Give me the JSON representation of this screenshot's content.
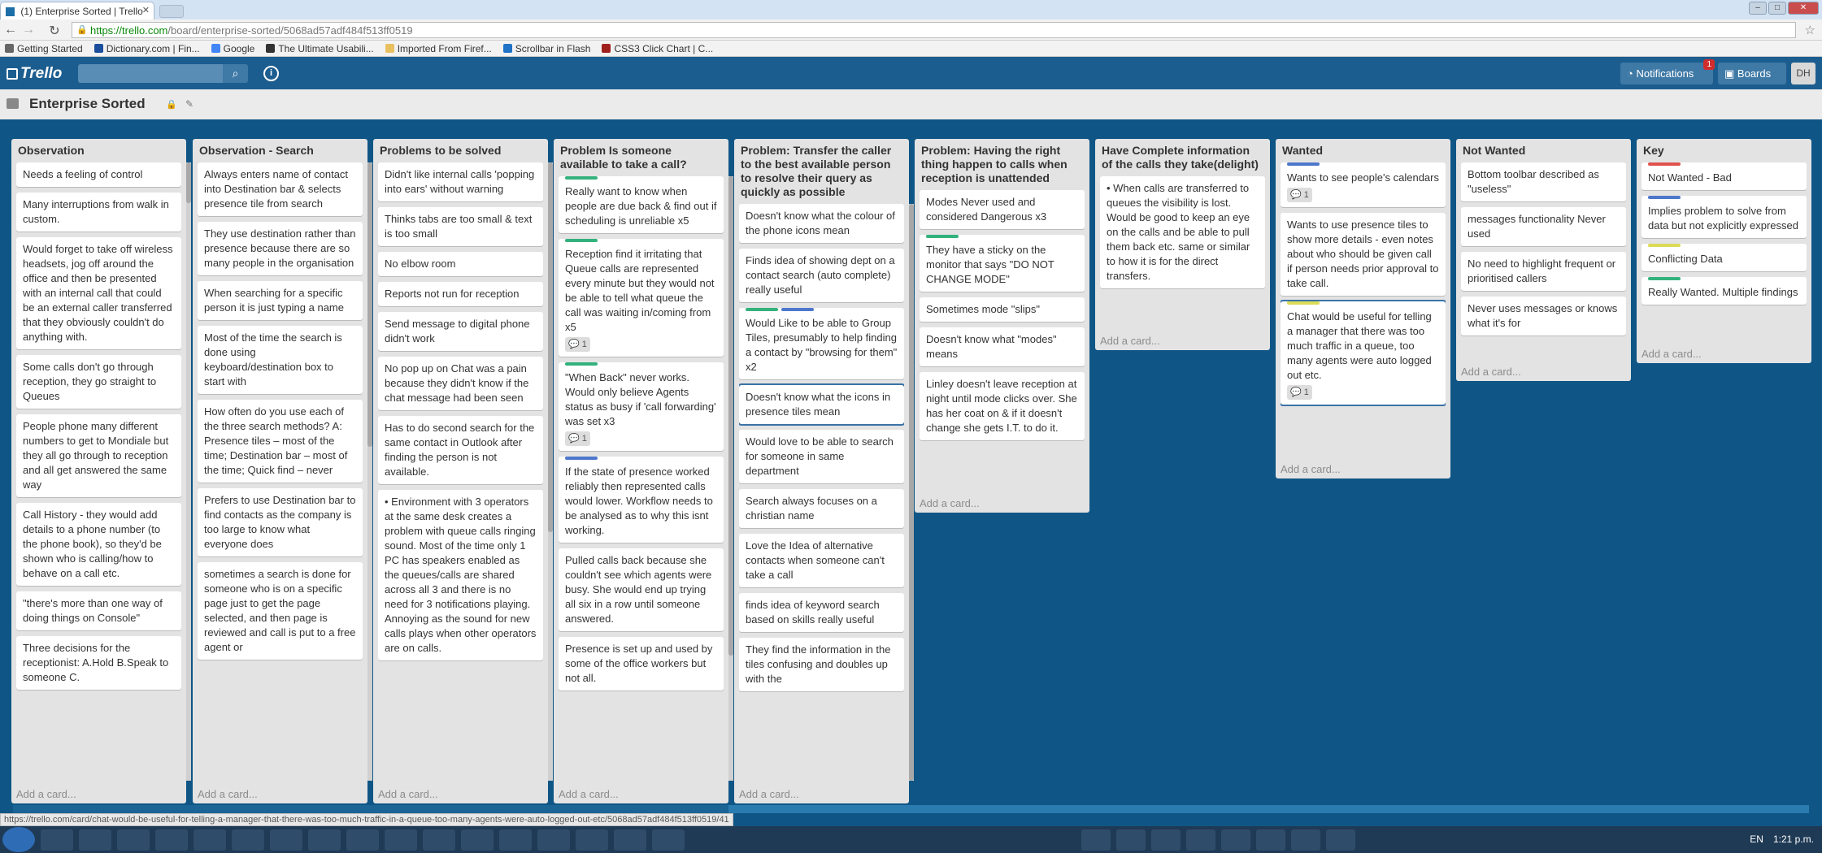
{
  "browser": {
    "tab_title": "(1) Enterprise Sorted | Trello",
    "url_scheme": "https://",
    "url_host": "trello.com",
    "url_path": "/board/enterprise-sorted/5068ad57adf484f513ff0519",
    "bookmarks": [
      {
        "label": "Getting Started",
        "color": "#666"
      },
      {
        "label": "Dictionary.com | Fin...",
        "color": "#1b4f9c"
      },
      {
        "label": "Google",
        "color": "#4285f4"
      },
      {
        "label": "The Ultimate Usabili...",
        "color": "#333"
      },
      {
        "label": "Imported From Firef...",
        "color": "#e8c060"
      },
      {
        "label": "Scrollbar in Flash",
        "color": "#1f72c6"
      },
      {
        "label": "CSS3 Click Chart | C...",
        "color": "#a0201e"
      }
    ],
    "status_url": "https://trello.com/card/chat-would-be-useful-for-telling-a-manager-that-there-was-too-much-traffic-in-a-queue-too-many-agents-were-auto-logged-out-etc/5068ad57adf484f513ff0519/41"
  },
  "header": {
    "logo": "Trello",
    "notifications_label": "Notifications",
    "notifications_count": "1",
    "boards_label": "Boards",
    "avatar_initials": "DH"
  },
  "board": {
    "title": "Enterprise Sorted",
    "add_card_label": "Add a card..."
  },
  "colors": {
    "green": "#34b27d",
    "blue": "#4d77cb",
    "yellow": "#dbdb57",
    "red": "#e0524c"
  },
  "lists": [
    {
      "name": "Observation",
      "cards": [
        {
          "text": "Needs a feeling of control"
        },
        {
          "text": "Many interruptions from walk in custom."
        },
        {
          "text": "Would forget to take off wireless headsets, jog off around the office and then be presented with an internal call that could be an external caller transferred that they obviously couldn't do anything with."
        },
        {
          "text": "Some calls don't go through reception, they go straight to Queues"
        },
        {
          "text": "People phone many different numbers to get to Mondiale but they all go through to reception and all get answered the same way"
        },
        {
          "text": "Call History - they would add details to a phone number (to the phone book), so they'd be shown who is calling/how to behave on a call etc."
        },
        {
          "text": "\"there's more than one way of doing things on Console\""
        },
        {
          "text": "Three decisions for the receptionist: A.Hold B.Speak to someone C."
        }
      ]
    },
    {
      "name": "Observation - Search",
      "cards": [
        {
          "text": "Always enters name of contact into Destination bar & selects presence tile from search"
        },
        {
          "text": "They use destination rather than presence because there are so many people in the organisation"
        },
        {
          "text": "When searching for a specific person it is just typing a name"
        },
        {
          "text": "Most of the time the search is done using keyboard/destination box to start with"
        },
        {
          "text": "How often do you use each of the three search methods? A: Presence tiles – most of the time; Destination bar – most of the time; Quick find – never"
        },
        {
          "text": "Prefers to use Destination bar to find contacts as the company is too large to know what everyone does"
        },
        {
          "text": "sometimes a search is done for someone who is on a specific page just to get the page selected, and then page is reviewed and call is put to a free agent or"
        }
      ]
    },
    {
      "name": "Problems to be solved",
      "cards": [
        {
          "text": "Didn't like internal calls 'popping into ears' without warning"
        },
        {
          "text": "Thinks tabs are too small & text is too small"
        },
        {
          "text": "No elbow room"
        },
        {
          "text": "Reports not run for reception"
        },
        {
          "text": "Send message to digital phone didn't work"
        },
        {
          "text": "No pop up on Chat was a pain because they didn't know if the chat message had been seen"
        },
        {
          "text": "Has to do second search for the same contact in Outlook after finding the person is not available."
        },
        {
          "text": "• Environment with 3 operators at the same desk creates a problem with queue calls ringing sound. Most of the time only 1 PC has speakers enabled as the queues/calls are shared across all 3 and there is no need for 3 notifications playing. Annoying as the sound for new calls plays when other operators are on calls."
        }
      ]
    },
    {
      "name": "Problem Is someone available to take a call?",
      "cards": [
        {
          "text": "Really want to know when people are due back & find out if scheduling is unreliable x5",
          "labels": [
            "green"
          ]
        },
        {
          "text": "Reception find it irritating that Queue calls are represented every minute but they would not be able to tell what queue the call was waiting in/coming from x5",
          "labels": [
            "green"
          ],
          "comments": "1"
        },
        {
          "text": "\"When Back\" never works. Would only believe Agents status as busy if 'call forwarding' was set x3",
          "labels": [
            "green"
          ],
          "comments": "1"
        },
        {
          "text": "If the state of presence worked reliably then represented calls would lower. Workflow needs to be analysed as to why this isnt working.",
          "labels": [
            "blue"
          ]
        },
        {
          "text": "Pulled calls back because she couldn't see which agents were busy. She would end up trying all six in a row until someone answered."
        },
        {
          "text": "Presence is set up and used by some of the office workers but not all."
        }
      ]
    },
    {
      "name": "Problem: Transfer the caller to the best available person to resolve their query as quickly as possible",
      "cards": [
        {
          "text": "Doesn't know what the colour of the phone icons mean"
        },
        {
          "text": "Finds idea of showing dept on a contact search (auto complete) really useful"
        },
        {
          "text": "Would Like to be able to Group Tiles, presumably to help finding a contact by \"browsing for them\" x2",
          "labels": [
            "green",
            "blue"
          ]
        },
        {
          "text": "Doesn't know what the icons in presence tiles mean",
          "selected": true
        },
        {
          "text": "Would love to be able to search for someone in same department"
        },
        {
          "text": "Search always focuses on a christian name"
        },
        {
          "text": "Love the Idea of alternative contacts when someone can't take a call"
        },
        {
          "text": "finds idea of keyword search based on skills really useful"
        },
        {
          "text": "They find the information in the tiles confusing and doubles up with the"
        }
      ]
    },
    {
      "name": "Problem: Having the right thing happen to calls when reception is unattended",
      "cards": [
        {
          "text": "Modes Never used and considered Dangerous x3"
        },
        {
          "text": "They have a sticky on the monitor that says \"DO NOT CHANGE MODE\"",
          "labels": [
            "green"
          ]
        },
        {
          "text": "Sometimes mode \"slips\""
        },
        {
          "text": "Doesn't know what \"modes\" means"
        },
        {
          "text": "Linley doesn't leave reception at night until mode clicks over. She has her coat on & if it doesn't change she gets I.T. to do it."
        }
      ]
    },
    {
      "name": "Have Complete information of the calls they take(delight)",
      "cards": [
        {
          "text": "• When calls are transferred to queues the visibility is lost. Would be good to keep an eye on the calls and be able to pull them back etc. same or similar to how it is for the direct transfers."
        }
      ]
    },
    {
      "name": "Wanted",
      "cards": [
        {
          "text": "Wants to see people's calendars",
          "labels": [
            "blue"
          ],
          "comments": "1"
        },
        {
          "text": "Wants to use presence tiles to show more details - even notes about who should be given call if person needs prior approval to take call."
        },
        {
          "text": "Chat would be useful for telling a manager that there was too much traffic in a queue, too many agents were auto logged out etc.",
          "labels": [
            "yellow"
          ],
          "comments": "1",
          "selected": true
        }
      ]
    },
    {
      "name": "Not Wanted",
      "cards": [
        {
          "text": "Bottom toolbar described as \"useless\""
        },
        {
          "text": "messages functionality Never used"
        },
        {
          "text": "No need to highlight frequent or prioritised callers"
        },
        {
          "text": "Never uses messages or knows what it's for"
        }
      ]
    },
    {
      "name": "Key",
      "cards": [
        {
          "text": "Not Wanted - Bad",
          "labels": [
            "red"
          ]
        },
        {
          "text": "Implies problem to solve from data but not explicitly expressed",
          "labels": [
            "blue"
          ]
        },
        {
          "text": "Conflicting Data",
          "labels": [
            "yellow"
          ]
        },
        {
          "text": "Really Wanted. Multiple findings",
          "labels": [
            "green"
          ]
        }
      ]
    }
  ],
  "taskbar": {
    "language": "EN",
    "time": "1:21 p.m."
  }
}
